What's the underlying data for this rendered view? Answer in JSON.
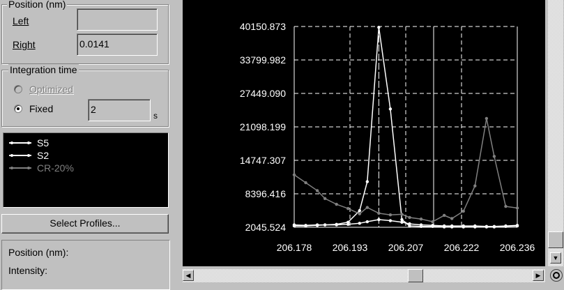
{
  "position_group": {
    "title": "Position (nm)",
    "left_label": "Left",
    "left_value": "",
    "right_label": "Right",
    "right_value": "0.0141"
  },
  "integration_group": {
    "title": "Integration time",
    "optimized_label": "Optimized",
    "fixed_label": "Fixed",
    "fixed_value": "2",
    "unit": "s",
    "selected": "fixed"
  },
  "profiles": {
    "items": [
      {
        "name": "S5",
        "color": "#ffffff"
      },
      {
        "name": "S2",
        "color": "#ffffff"
      },
      {
        "name": "CR-20%",
        "color": "#808080"
      }
    ],
    "select_button": "Select Profiles..."
  },
  "readout": {
    "position_label": "Position (nm):",
    "intensity_label": "Intensity:"
  },
  "colors": {
    "plot_background": "#000000",
    "grid": "#ffffff",
    "series_s5": "#ffffff",
    "series_s2": "#ffffff",
    "series_cr20": "#808080"
  },
  "chart_data": {
    "type": "line",
    "title": "",
    "xlabel": "",
    "ylabel": "",
    "y_ticks": [
      "40150.873",
      "33799.982",
      "27449.090",
      "21098.199",
      "14747.307",
      "8396.416",
      "2045.524"
    ],
    "x_ticks": [
      "206.178",
      "206.193",
      "206.207",
      "206.222",
      "206.236"
    ],
    "xlim": [
      206.178,
      206.236
    ],
    "ylim": [
      2045.524,
      40150.873
    ],
    "grid": true,
    "center_marker_x": 206.2,
    "series": [
      {
        "name": "S5",
        "x": [
          206.178,
          206.181,
          206.184,
          206.186,
          206.189,
          206.192,
          206.195,
          206.197,
          206.2,
          206.203,
          206.206,
          206.208,
          206.211,
          206.214,
          206.217,
          206.219,
          206.222,
          206.225,
          206.228,
          206.23,
          206.233,
          206.236
        ],
        "y": [
          2500,
          2400,
          2500,
          2500,
          2600,
          3000,
          5200,
          10700,
          40000,
          24500,
          3500,
          2300,
          2200,
          2200,
          2100,
          2100,
          2100,
          2100,
          2100,
          2100,
          2200,
          2300
        ]
      },
      {
        "name": "S2",
        "x": [
          206.178,
          206.181,
          206.184,
          206.186,
          206.189,
          206.192,
          206.195,
          206.197,
          206.2,
          206.203,
          206.206,
          206.208,
          206.211,
          206.214,
          206.217,
          206.219,
          206.222,
          206.225,
          206.228,
          206.23,
          206.233,
          206.236
        ],
        "y": [
          2300,
          2300,
          2400,
          2500,
          2500,
          2600,
          2800,
          3100,
          3500,
          3300,
          3000,
          2700,
          2500,
          2400,
          2300,
          2300,
          2300,
          2300,
          2200,
          2200,
          2300,
          2400
        ]
      },
      {
        "name": "CR-20%",
        "x": [
          206.178,
          206.181,
          206.184,
          206.186,
          206.189,
          206.192,
          206.195,
          206.197,
          206.2,
          206.203,
          206.206,
          206.208,
          206.211,
          206.214,
          206.217,
          206.219,
          206.222,
          206.225,
          206.228,
          206.23,
          206.233,
          206.236
        ],
        "y": [
          12000,
          10500,
          9000,
          7500,
          6400,
          5600,
          4600,
          5800,
          4700,
          4400,
          4500,
          3900,
          3600,
          3100,
          4300,
          3700,
          5100,
          9900,
          22700,
          15500,
          6000,
          5700
        ]
      }
    ]
  }
}
